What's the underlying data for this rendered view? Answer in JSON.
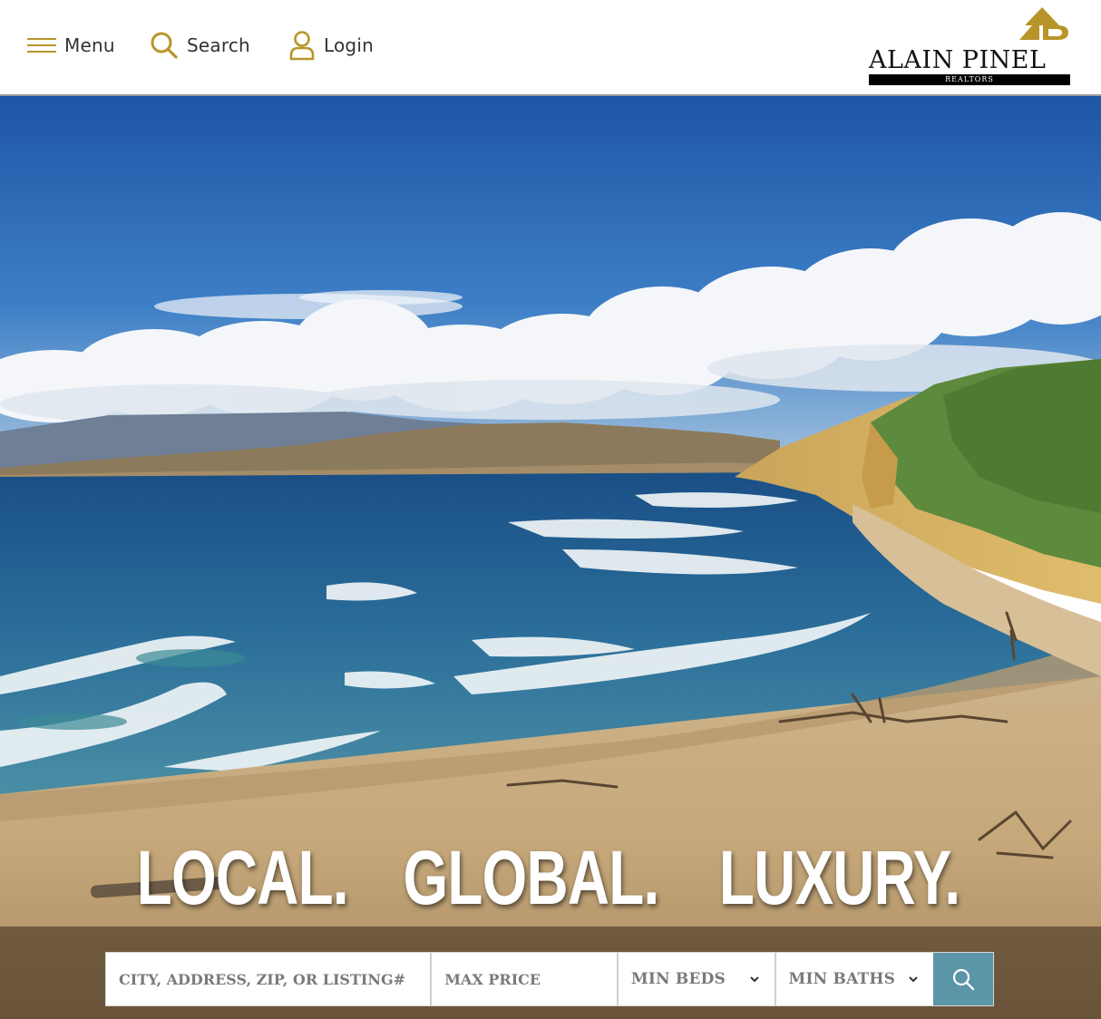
{
  "header": {
    "menu_label": "Menu",
    "search_label": "Search",
    "login_label": "Login",
    "icons": [
      "hamburger-icon",
      "search-icon",
      "user-icon"
    ]
  },
  "logo": {
    "wordmark": "ALAIN PINEL",
    "subline": "REALTORS",
    "mark_color": "#b8952a"
  },
  "hero": {
    "tagline": [
      "LOCAL.",
      "GLOBAL.",
      "LUXURY."
    ],
    "search": {
      "location_placeholder": "CITY, ADDRESS, ZIP, OR LISTING#",
      "price_placeholder": "MAX PRICE",
      "beds_value": "MIN BEDS",
      "baths_value": "MIN BATHS",
      "button_icon": "search-icon"
    }
  },
  "colors": {
    "accent_gold": "#b8952a",
    "search_button": "#5b95a8",
    "nav_text": "#333333"
  }
}
